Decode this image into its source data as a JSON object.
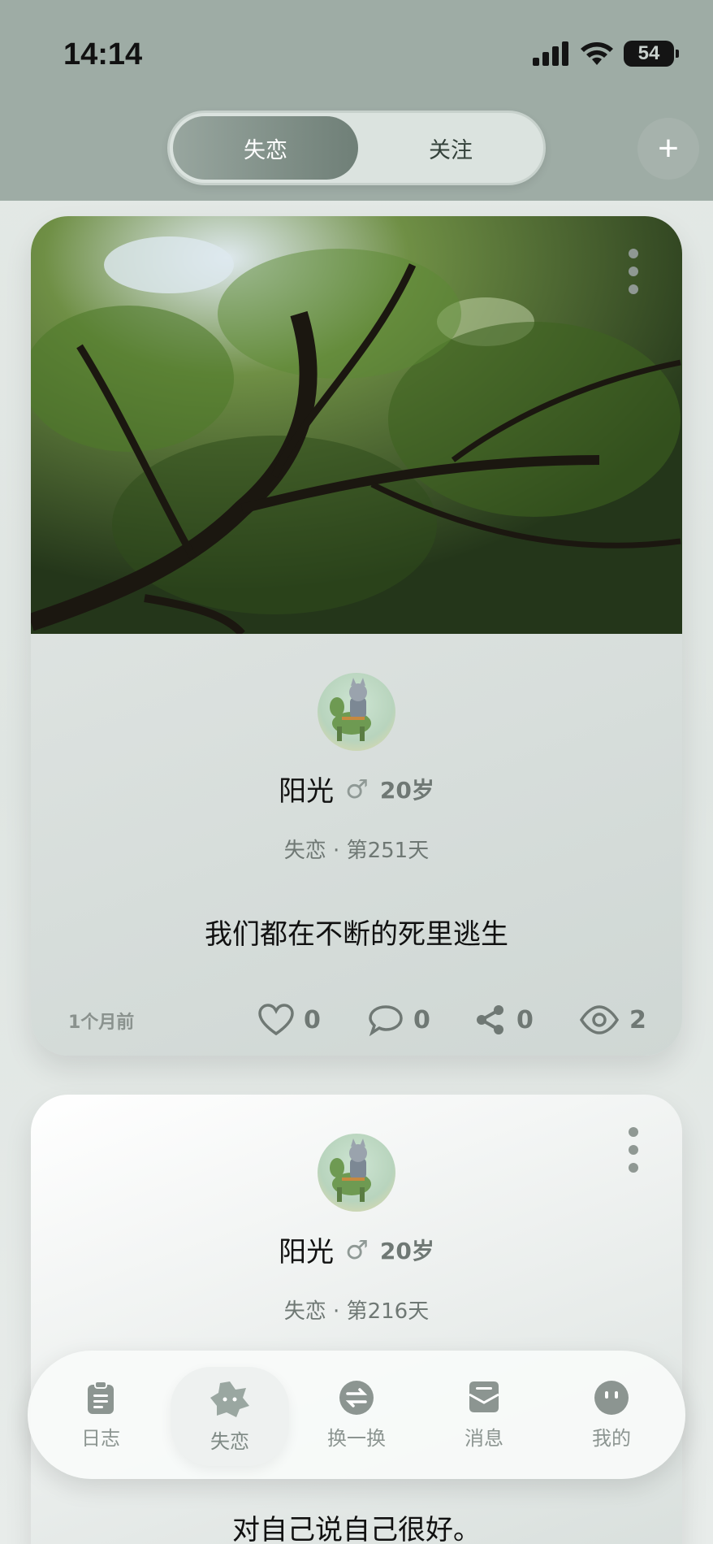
{
  "status_bar": {
    "time": "14:14",
    "battery": "54"
  },
  "top_tabs": {
    "active": "失恋",
    "inactive": "关注"
  },
  "add_button": "+",
  "posts": [
    {
      "name": "阳光",
      "gender_symbol": "♂",
      "age": "20岁",
      "status": "失恋 · 第251天",
      "text": "我们都在不断的死里逃生",
      "time_ago": "1个月前",
      "likes": "0",
      "comments": "0",
      "shares": "0",
      "views": "2"
    },
    {
      "name": "阳光",
      "gender_symbol": "♂",
      "age": "20岁",
      "status": "失恋 · 第216天",
      "text": "对自己说自己很好。"
    }
  ],
  "tabbar": [
    {
      "label": "日志",
      "icon": "clipboard-icon"
    },
    {
      "label": "失恋",
      "icon": "broken-flower-icon"
    },
    {
      "label": "换一换",
      "icon": "swap-icon"
    },
    {
      "label": "消息",
      "icon": "message-icon"
    },
    {
      "label": "我的",
      "icon": "face-icon"
    }
  ],
  "colors": {
    "header": "#9eaca5",
    "accent": "#6f7f77",
    "muted": "#8c9591"
  }
}
